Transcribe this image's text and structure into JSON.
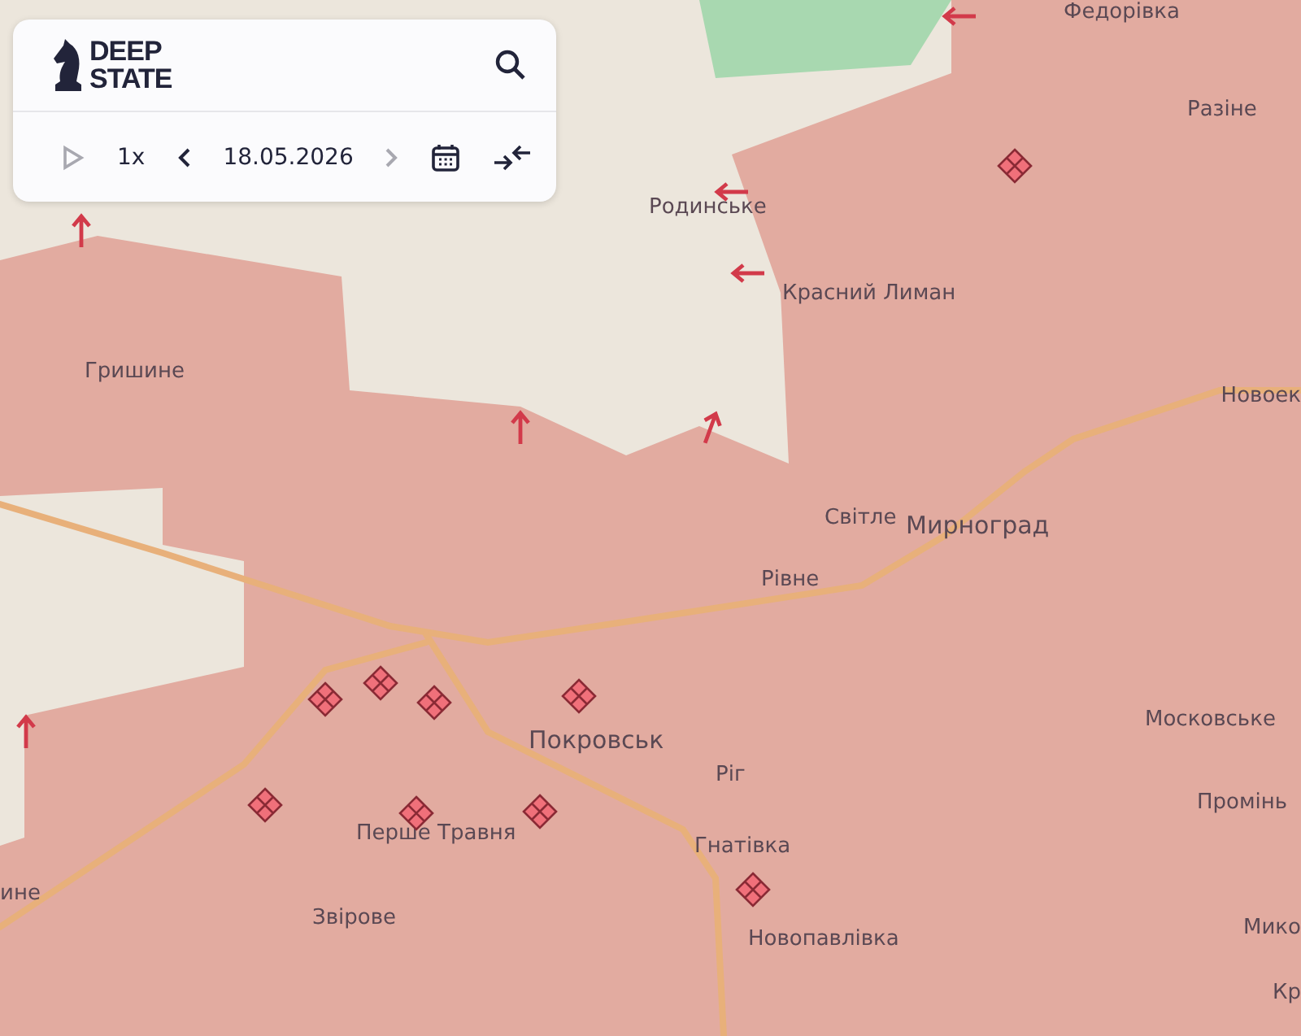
{
  "panel": {
    "logo": [
      "DEEP",
      "STATE"
    ],
    "playback": {
      "play": {
        "disabled": true
      },
      "speed": "1x",
      "prev": {
        "disabled": false
      },
      "date": "18.05.2026",
      "next": {
        "disabled": true
      }
    }
  },
  "map": {
    "labels": [
      {
        "text": "Федорівка",
        "kind": "village"
      },
      {
        "text": "Разіне",
        "kind": "village"
      },
      {
        "text": "Родинське",
        "kind": "village"
      },
      {
        "text": "Красний Лиман",
        "kind": "village"
      },
      {
        "text": "Гришине",
        "kind": "village"
      },
      {
        "text": "Новоек",
        "kind": "village"
      },
      {
        "text": "Світле",
        "kind": "village"
      },
      {
        "text": "Мирноград",
        "kind": "city"
      },
      {
        "text": "Рівне",
        "kind": "village"
      },
      {
        "text": "Московське",
        "kind": "village"
      },
      {
        "text": "Покровськ",
        "kind": "city"
      },
      {
        "text": "Ріг",
        "kind": "village"
      },
      {
        "text": "Промінь",
        "kind": "village"
      },
      {
        "text": "Перше Травня",
        "kind": "village"
      },
      {
        "text": "Гнатівка",
        "kind": "village"
      },
      {
        "text": "ине",
        "kind": "village"
      },
      {
        "text": "Звірове",
        "kind": "village"
      },
      {
        "text": "Новопавлівка",
        "kind": "village"
      },
      {
        "text": "Мико",
        "kind": "village"
      },
      {
        "text": "Кр",
        "kind": "village"
      }
    ]
  }
}
